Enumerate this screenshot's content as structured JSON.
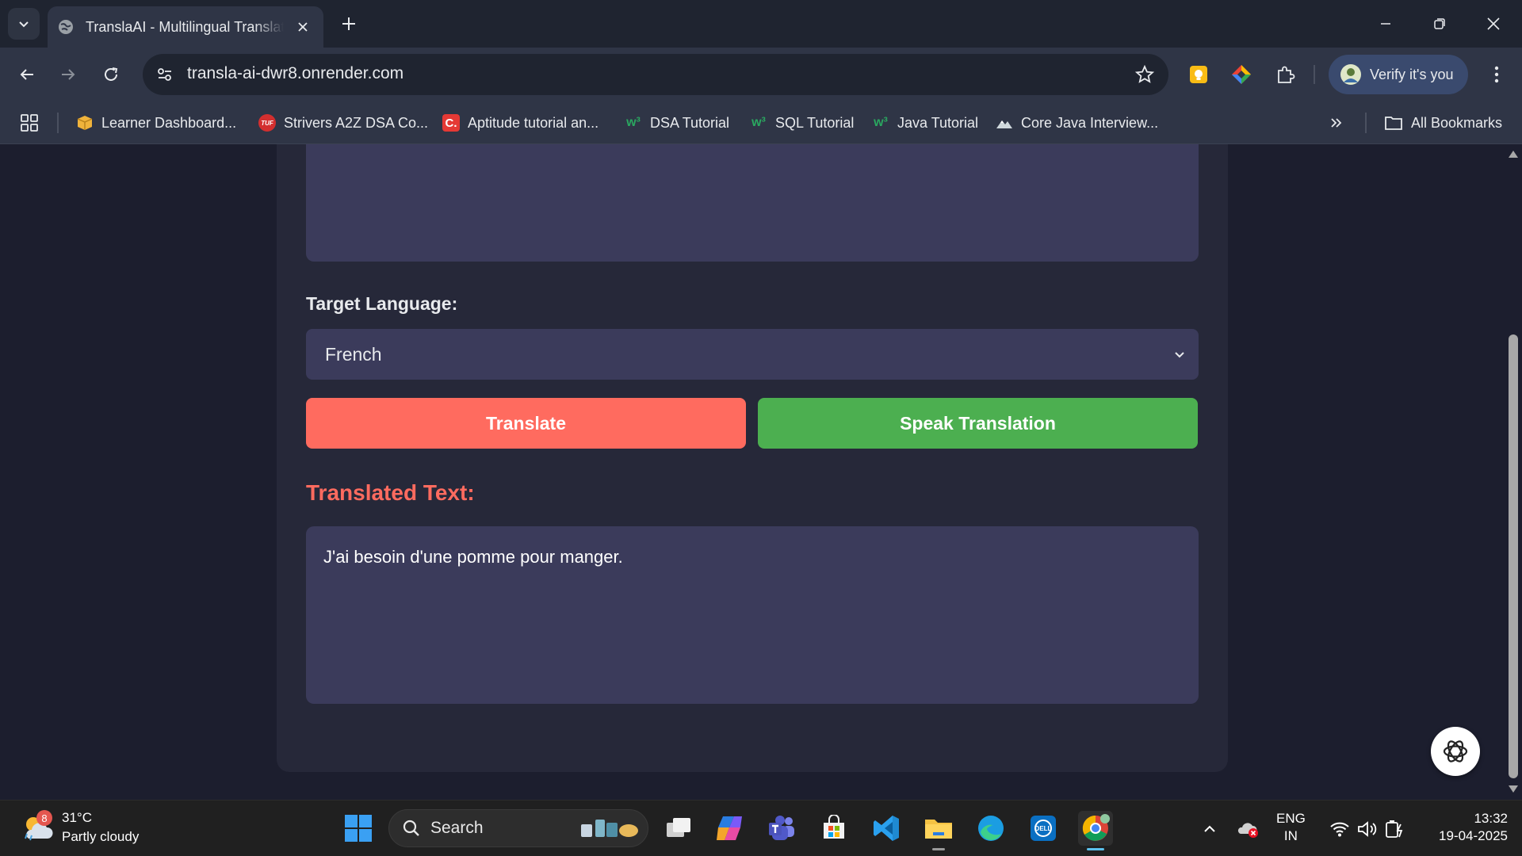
{
  "browser": {
    "tab_title": "TranslaAI - Multilingual Translator",
    "url": "transla-ai-dwr8.onrender.com",
    "profile_label": "Verify it's you"
  },
  "bookmarks": [
    {
      "label": "Learner Dashboard...",
      "icon": "package-icon"
    },
    {
      "label": "Strivers A2Z DSA Co...",
      "icon": "tuf-icon"
    },
    {
      "label": "Aptitude tutorial an...",
      "icon": "c-logo-icon"
    },
    {
      "label": "DSA Tutorial",
      "icon": "w3-icon"
    },
    {
      "label": "SQL Tutorial",
      "icon": "w3-icon"
    },
    {
      "label": "Java Tutorial",
      "icon": "w3-icon"
    },
    {
      "label": "Core Java Interview...",
      "icon": "mountain-icon"
    }
  ],
  "all_bookmarks_label": "All Bookmarks",
  "page": {
    "target_language_label": "Target Language:",
    "selected_language": "French",
    "translate_button": "Translate",
    "speak_button": "Speak Translation",
    "translated_heading": "Translated Text:",
    "translated_text": "J'ai besoin d'une pomme pour manger."
  },
  "colors": {
    "accent_red": "#ff6b5f",
    "accent_green": "#4caf50",
    "panel": "#3b3b5b"
  },
  "taskbar": {
    "weather_badge": "8",
    "temperature": "31°C",
    "condition": "Partly cloudy",
    "search_label": "Search",
    "lang_line1": "ENG",
    "lang_line2": "IN",
    "time": "13:32",
    "date": "19-04-2025"
  }
}
